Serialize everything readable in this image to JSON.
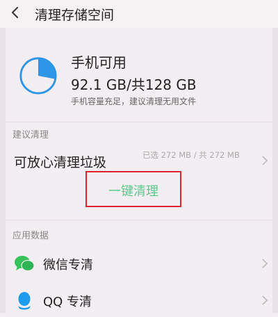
{
  "header": {
    "title": "清理存储空间",
    "back_icon": "chevron-left-icon"
  },
  "storage": {
    "title": "手机可用",
    "amount": "92.1 GB/共128 GB",
    "note": "手机容量充足，建议清理无用文件",
    "used_fraction": 0.28,
    "icon": "storage-pie-icon"
  },
  "recommend": {
    "section_label": "建议清理",
    "junk_label": "可放心清理垃圾",
    "junk_stat": "已选 272 MB / 共 272 MB",
    "one_click_label": "一键清理"
  },
  "app_data": {
    "section_label": "应用数据",
    "items": [
      {
        "label": "微信专清",
        "icon": "wechat-icon"
      },
      {
        "label": "QQ 专清",
        "icon": "qq-icon"
      }
    ]
  },
  "colors": {
    "accent_blue": "#2f95e6",
    "accent_green": "#5cc98c",
    "highlight_red": "#e2232a",
    "background": "#f3eef1"
  }
}
